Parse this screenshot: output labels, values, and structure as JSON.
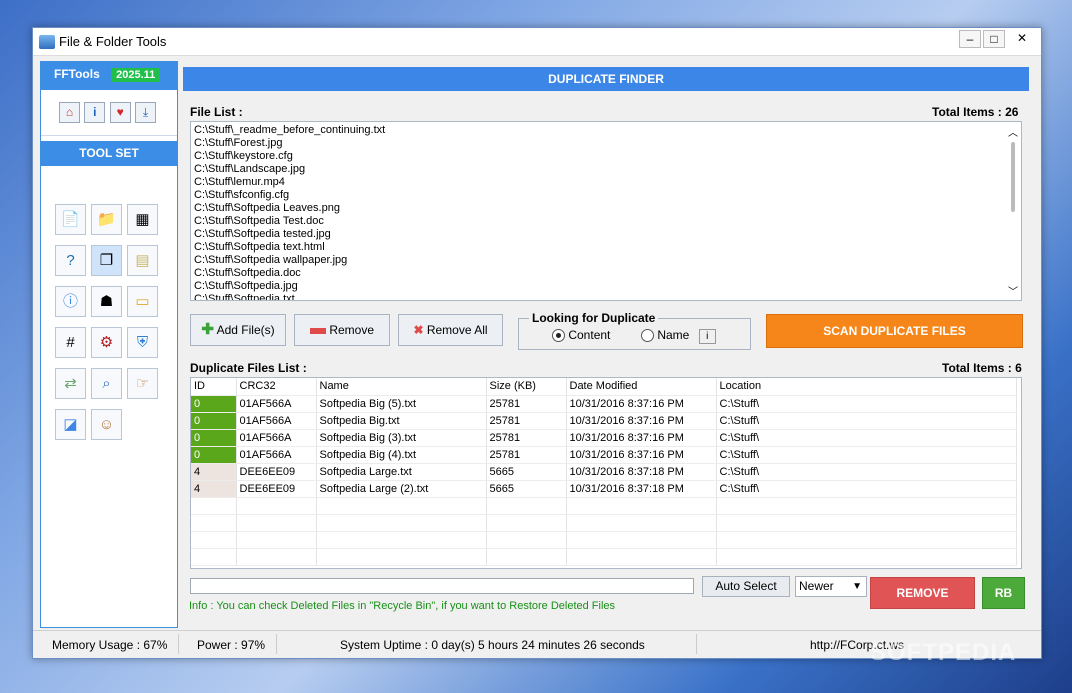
{
  "window": {
    "title": "File & Folder Tools",
    "min": "‒",
    "max": "□",
    "close": "✕"
  },
  "sidebar": {
    "brand": "FFTools",
    "version": "2025.11",
    "toolset": "TOOL SET"
  },
  "header": {
    "title": "DUPLICATE FINDER"
  },
  "file_list": {
    "label": "File List :",
    "total": "Total Items : 26",
    "items": [
      "C:\\Stuff\\_readme_before_continuing.txt",
      "C:\\Stuff\\Forest.jpg",
      "C:\\Stuff\\keystore.cfg",
      "C:\\Stuff\\Landscape.jpg",
      "C:\\Stuff\\lemur.mp4",
      "C:\\Stuff\\sfconfig.cfg",
      "C:\\Stuff\\Softpedia Leaves.png",
      "C:\\Stuff\\Softpedia Test.doc",
      "C:\\Stuff\\Softpedia tested.jpg",
      "C:\\Stuff\\Softpedia text.html",
      "C:\\Stuff\\Softpedia wallpaper.jpg",
      "C:\\Stuff\\Softpedia.doc",
      "C:\\Stuff\\Softpedia.jpg",
      "C:\\Stuff\\Softpedia.txt"
    ]
  },
  "actions": {
    "add": "Add File(s)",
    "remove": "Remove",
    "remove_all": "Remove All"
  },
  "looking": {
    "title": "Looking for Duplicate",
    "content": "Content",
    "name": "Name",
    "info": "i"
  },
  "scan": "SCAN DUPLICATE FILES",
  "dupes": {
    "label": "Duplicate Files List :",
    "total": "Total Items : 6",
    "columns": [
      "ID",
      "CRC32",
      "Name",
      "Size (KB)",
      "Date Modified",
      "Location"
    ],
    "rows": [
      [
        "0",
        "01AF566A",
        "Softpedia Big (5).txt",
        "25781",
        "10/31/2016 8:37:16 PM",
        "C:\\Stuff\\"
      ],
      [
        "0",
        "01AF566A",
        "Softpedia Big.txt",
        "25781",
        "10/31/2016 8:37:16 PM",
        "C:\\Stuff\\"
      ],
      [
        "0",
        "01AF566A",
        "Softpedia Big (3).txt",
        "25781",
        "10/31/2016 8:37:16 PM",
        "C:\\Stuff\\"
      ],
      [
        "0",
        "01AF566A",
        "Softpedia Big (4).txt",
        "25781",
        "10/31/2016 8:37:16 PM",
        "C:\\Stuff\\"
      ],
      [
        "4",
        "DEE6EE09",
        "Softpedia Large.txt",
        "5665",
        "10/31/2016 8:37:18 PM",
        "C:\\Stuff\\"
      ],
      [
        "4",
        "DEE6EE09",
        "Softpedia Large (2).txt",
        "5665",
        "10/31/2016 8:37:18 PM",
        "C:\\Stuff\\"
      ]
    ]
  },
  "bottom": {
    "auto_select": "Auto Select",
    "newer": "Newer",
    "remove": "REMOVE",
    "rb": "RB",
    "info": "Info : You can check Deleted Files in \"Recycle Bin\", if you want to Restore Deleted Files"
  },
  "status": {
    "memory": "Memory Usage : 67%",
    "power": "Power : 97%",
    "uptime": "System Uptime : 0 day(s) 5 hours 24 minutes 26 seconds",
    "url": "http://FCorp.ct.ws"
  },
  "watermark": "SOFTPEDIA"
}
